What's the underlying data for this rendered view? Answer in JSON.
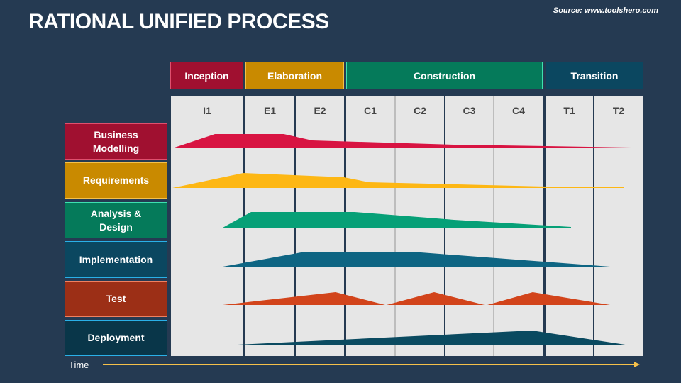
{
  "title": "RATIONAL UNIFIED PROCESS",
  "source": "Source: www.toolshero.com",
  "phases": [
    {
      "label": "Inception",
      "bg": "#a01030",
      "border": "#e0506e"
    },
    {
      "label": "Elaboration",
      "bg": "#c98a00",
      "border": "#f5c04a"
    },
    {
      "label": "Construction",
      "bg": "#057a5a",
      "border": "#3ee0b0"
    },
    {
      "label": "Transition",
      "bg": "#0b4760",
      "border": "#2ab0e8"
    }
  ],
  "iterations": [
    "I1",
    "E1",
    "E2",
    "C1",
    "C2",
    "C3",
    "C4",
    "T1",
    "T2"
  ],
  "disciplines": [
    {
      "label": "Business Modelling",
      "bg": "#a01030",
      "border": "#e0506e",
      "shape_color": "#d81442"
    },
    {
      "label": "Requirements",
      "bg": "#c98a00",
      "border": "#f5c04a",
      "shape_color": "#fdb714"
    },
    {
      "label": "Analysis & Design",
      "bg": "#057a5a",
      "border": "#3ee0b0",
      "shape_color": "#06a077"
    },
    {
      "label": "Implementation",
      "bg": "#0b4760",
      "border": "#2ab0e8",
      "shape_color": "#0e6583"
    },
    {
      "label": "Test",
      "bg": "#9c2f16",
      "border": "#f08060",
      "shape_color": "#d2441b"
    },
    {
      "label": "Deployment",
      "bg": "#093649",
      "border": "#2ab0e8",
      "shape_color": "#0a4a60"
    }
  ],
  "time_label": "Time",
  "time_arrow_color": "#f5c04a"
}
